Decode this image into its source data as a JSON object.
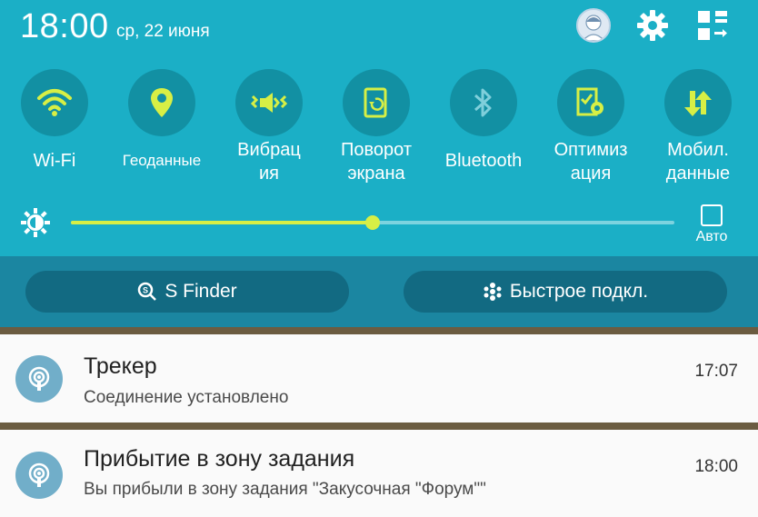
{
  "status_bar": {
    "time": "18:00",
    "date": "ср, 22 июня"
  },
  "quick_toggles": [
    {
      "label": "Wi-Fi",
      "icon": "wifi-icon",
      "active": true
    },
    {
      "label": "Геоданные",
      "icon": "location-icon",
      "active": true
    },
    {
      "label": "Вибрация",
      "icon": "vibration-icon",
      "active": true
    },
    {
      "label": "Поворот экрана",
      "icon": "rotate-screen-icon",
      "active": true
    },
    {
      "label": "Bluetooth",
      "icon": "bluetooth-icon",
      "active": false
    },
    {
      "label": "Оптимизация",
      "icon": "optimization-icon",
      "active": true
    },
    {
      "label": "Мобил. данные",
      "icon": "mobile-data-icon",
      "active": true
    }
  ],
  "brightness": {
    "level": 0.5,
    "auto_label": "Авто",
    "auto_checked": false
  },
  "actions": {
    "sfinder_label": "S Finder",
    "quick_connect_label": "Быстрое подкл."
  },
  "notifications": [
    {
      "title": "Трекер",
      "text": "Соединение установлено",
      "time": "17:07",
      "icon": "tracker-icon"
    },
    {
      "title": "Прибытие в зону задания",
      "text": "Вы прибыли в зону задания \"Закусочная \"Форум\"\"",
      "time": "18:00",
      "icon": "tracker-icon"
    }
  ],
  "colors": {
    "panel_bg": "#1bafc6",
    "toggle_circle": "#1290a3",
    "active_icon": "#d7ef45",
    "inactive_icon": "#7fcfdb",
    "buttons_bar": "#1b86a1",
    "pill_bg": "#126a82",
    "notification_icon_bg": "#71aec9"
  }
}
